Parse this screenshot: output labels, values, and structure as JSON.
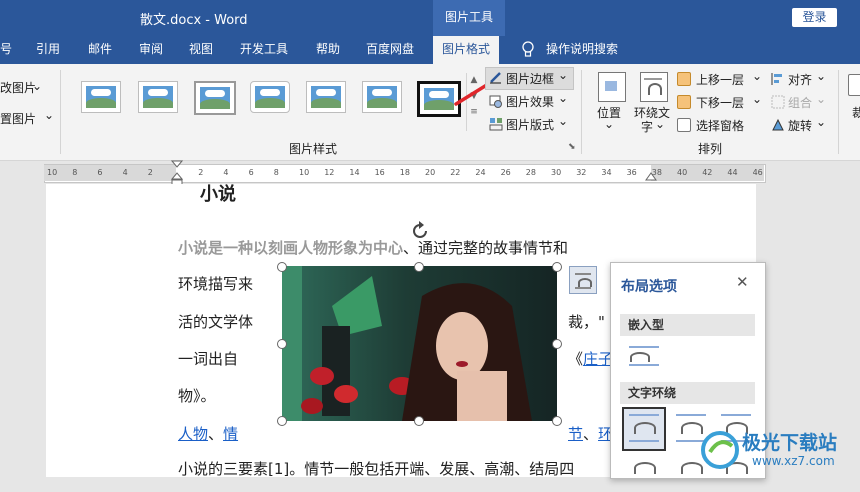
{
  "window": {
    "doc_title": "散文.docx  -  Word",
    "context_tool": "图片工具",
    "login": "登录"
  },
  "tabs": [
    {
      "label": "号"
    },
    {
      "label": "引用"
    },
    {
      "label": "邮件"
    },
    {
      "label": "审阅"
    },
    {
      "label": "视图"
    },
    {
      "label": "开发工具"
    },
    {
      "label": "帮助"
    },
    {
      "label": "百度网盘"
    },
    {
      "label": "图片格式"
    },
    {
      "label": "操作说明搜索"
    }
  ],
  "ribbon": {
    "left_items": [
      "改图片",
      "置图片"
    ],
    "group_picture_styles": "图片样式",
    "border": "图片边框",
    "effects": "图片效果",
    "layout": "图片版式",
    "position": "位置",
    "wrap_text_1": "环绕文",
    "wrap_text_2": "字",
    "bring_forward": "上移一层",
    "send_backward": "下移一层",
    "selection_pane": "选择窗格",
    "align": "对齐",
    "group": "组合",
    "rotate": "旋转",
    "group_arrange": "排列",
    "edge_char": "裁"
  },
  "ruler": {
    "numbers": [
      "10",
      "8",
      "6",
      "4",
      "2",
      "2",
      "4",
      "6",
      "8",
      "10",
      "12",
      "14",
      "16",
      "18",
      "20",
      "22",
      "24",
      "26",
      "28",
      "30",
      "32",
      "34",
      "36",
      "38",
      "40",
      "42",
      "44",
      "46"
    ]
  },
  "document": {
    "heading": "小说",
    "line1_bold": "小说是一种以刻画人物形象为中心",
    "line1_rest": "、通过完整的故事情节和",
    "line2_left": "环境描写来",
    "line3_left": "活的文学体",
    "line3_right": "裁，\"",
    "line4_left": "一词出自",
    "line4_right_pre": "《",
    "line4_right_link": "庄子",
    "line5_left": "物》。",
    "line6_link1": "人物",
    "line6_sep": "、",
    "line6_link2": "情",
    "line6_right_link1": "节",
    "line6_right_sep": "、",
    "line6_right_link2": "环",
    "line7": "小说的三要素[1]。情节一般包括开端、发展、高潮、结局四"
  },
  "layout_panel": {
    "title": "布局选项",
    "section_inline": "嵌入型",
    "section_wrap": "文字环绕"
  },
  "watermark": {
    "name": "极光下载站",
    "url": "www.xz7.com"
  },
  "colors": {
    "brand": "#2b579a",
    "accent_red": "#e0262b",
    "link": "#1a5fc7"
  }
}
